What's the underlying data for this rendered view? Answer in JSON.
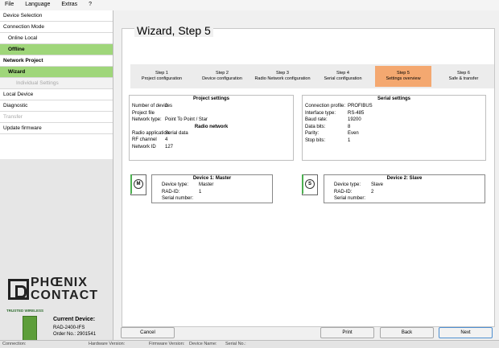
{
  "menu": [
    "File",
    "Language",
    "Extras",
    "?"
  ],
  "sidebar": [
    {
      "label": "Device Selection",
      "style": "normal"
    },
    {
      "label": "Connection Mode",
      "style": "normal"
    },
    {
      "label": "Online Local",
      "style": "sub"
    },
    {
      "label": "Offline",
      "style": "green"
    },
    {
      "label": "Network Project",
      "style": "bold"
    },
    {
      "label": "Wizard",
      "style": "wizard"
    },
    {
      "label": "Individual Settings",
      "style": "greysub"
    },
    {
      "label": "Local Device",
      "style": "normal"
    },
    {
      "label": "Diagnostic",
      "style": "normal"
    },
    {
      "label": "Transfer",
      "style": "gray"
    },
    {
      "label": "Update firmware",
      "style": "normal"
    }
  ],
  "logo": {
    "line1": "PHŒNIX",
    "line2": "CONTACT"
  },
  "current_device": {
    "badge": "TRUSTED WIRELESS",
    "title": "Current Device:",
    "model": "RAD-2400-IFS",
    "order": "Order No.: 2901541"
  },
  "wizard": {
    "title": "Wizard, Step 5",
    "steps": [
      {
        "line1": "Step 1",
        "line2": "Project configuration",
        "active": false
      },
      {
        "line1": "Step 2",
        "line2": "Device configuration",
        "active": false
      },
      {
        "line1": "Step 3",
        "line2": "Radio Network configuration",
        "active": false
      },
      {
        "line1": "Step 4",
        "line2": "Serial configuration",
        "active": false
      },
      {
        "line1": "Step 5",
        "line2": "Settings overview",
        "active": true
      },
      {
        "line1": "Step 6",
        "line2": "Safe & transfer",
        "active": false
      }
    ]
  },
  "project_settings": {
    "title": "Project settings",
    "rows": [
      {
        "k": "Number of devices",
        "v": "2"
      },
      {
        "k": "Project file",
        "v": ""
      },
      {
        "k": "Network type:",
        "v": "Point To Point / Star"
      }
    ],
    "radio_title": "Radio network",
    "radio_rows": [
      {
        "k": "Radio application:",
        "v": "Serial data"
      },
      {
        "k": "RF channel",
        "v": "4"
      },
      {
        "k": "Network ID",
        "v": "127"
      }
    ]
  },
  "serial_settings": {
    "title": "Serial settings",
    "rows": [
      {
        "k": "Connection profile:",
        "v": "PROFIBUS"
      },
      {
        "k": "Interface type:",
        "v": "RS-485"
      },
      {
        "k": "Baud rate:",
        "v": "19200"
      },
      {
        "k": "Data bits:",
        "v": "8"
      },
      {
        "k": "Parity:",
        "v": "Even"
      },
      {
        "k": "Stop bits:",
        "v": "1"
      }
    ]
  },
  "device1": {
    "icon_letter": "M",
    "title": "Device 1: Master",
    "rows": [
      {
        "k": "Device type:",
        "v": "Master"
      },
      {
        "k": "RAD-ID:",
        "v": "1"
      },
      {
        "k": "Serial number:",
        "v": ""
      }
    ]
  },
  "device2": {
    "icon_letter": "S",
    "title": "Device 2: Slave",
    "rows": [
      {
        "k": "Device type:",
        "v": "Slave"
      },
      {
        "k": "RAD-ID:",
        "v": "2"
      },
      {
        "k": "Serial number:",
        "v": ""
      }
    ]
  },
  "buttons": {
    "cancel": "Cancel",
    "print": "Print",
    "back": "Back",
    "next": "Next"
  },
  "status": {
    "connection": "Connection:",
    "hardware": "Hardware Version:",
    "firmware": "Firmware Version:",
    "device_name": "Device Name:",
    "serial": "Serial No.:"
  },
  "colors": {
    "active_step": "#f4a870",
    "sidebar_green": "#9fd67a"
  }
}
